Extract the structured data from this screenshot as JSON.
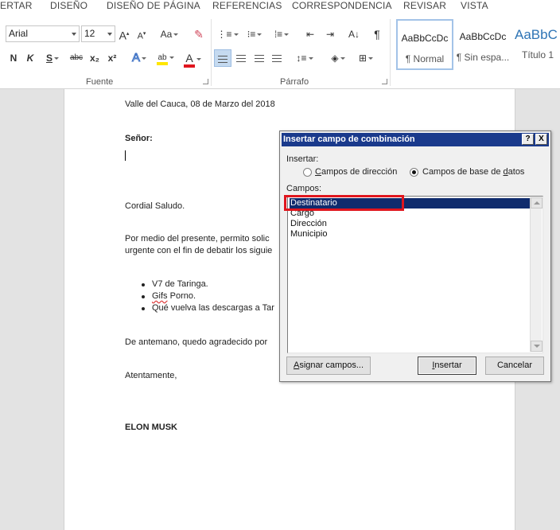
{
  "ribbon": {
    "tabs": [
      "ERTAR",
      "DISEÑO",
      "DISEÑO DE PÁGINA",
      "REFERENCIAS",
      "CORRESPONDENCIA",
      "REVISAR",
      "VISTA"
    ],
    "font": {
      "group_label": "Fuente",
      "font_name": "Arial",
      "font_size": "12",
      "grow_font": "A",
      "shrink_font": "A",
      "change_case": "Aa",
      "bold": "N",
      "italic": "K",
      "underline": "S",
      "strikethrough": "abc",
      "subscript": "x₂",
      "superscript": "x²",
      "text_effects": "A",
      "highlight": "ab",
      "font_color": "A"
    },
    "paragraph": {
      "group_label": "Párrafo",
      "sort": "A↓",
      "show_marks": "¶"
    },
    "styles": [
      {
        "preview": "AaBbCcDc",
        "name": "¶ Normal"
      },
      {
        "preview": "AaBbCcDc",
        "name": "¶ Sin espa..."
      },
      {
        "preview": "AaBbC",
        "name": "Título 1"
      }
    ]
  },
  "document": {
    "date_line": "Valle del Cauca, 08 de Marzo del 2018",
    "salutation": "Señor:",
    "greeting": "Cordial Saludo.",
    "body_line1": "Por medio del presente, permito solic",
    "body_line2": "urgente con el fin de debatir los siguie",
    "bullets": [
      {
        "prefix": "V7 de Taringa.",
        "marked": "",
        "suffix": ""
      },
      {
        "prefix": "",
        "marked": "Gifs",
        "suffix": " Porno."
      },
      {
        "prefix": "Qué vuelva las descargas a Tar",
        "marked": "",
        "suffix": ""
      }
    ],
    "closing_line": "De antemano, quedo agradecido por",
    "sign_off": "Atentamente,",
    "signature": "ELON MUSK"
  },
  "dialog": {
    "title": "Insertar campo de combinación",
    "help_button": "?",
    "close_button": "X",
    "insert_label": "Insertar:",
    "radio_address": {
      "key": "C",
      "rest": "ampos de dirección"
    },
    "radio_database": {
      "pre": "Campos de base de ",
      "key": "d",
      "post": "atos"
    },
    "fields_label": "Campos:",
    "fields": [
      "Destinatario",
      "Cargo",
      "Dirección",
      "Municipio"
    ],
    "selected_field": "Destinatario",
    "assign_button": {
      "key": "A",
      "rest": "signar campos..."
    },
    "insert_button": {
      "key": "I",
      "rest": "nsertar"
    },
    "cancel_button": "Cancelar",
    "colors": {
      "title_bar": "#1a3a8c",
      "selection": "#0f2b6d",
      "highlight_box": "#e0161e"
    }
  }
}
